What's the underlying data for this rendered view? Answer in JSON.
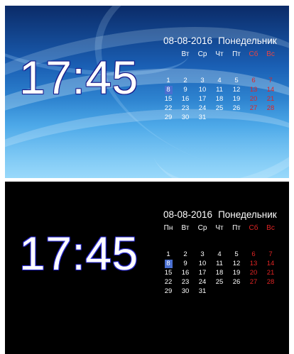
{
  "clock": {
    "time": "17:45"
  },
  "calendar": {
    "date": "08-08-2016",
    "day_name": "Понедельник",
    "weekdays": [
      "Пн",
      "Вт",
      "Ср",
      "Чт",
      "Пт",
      "Сб",
      "Вс"
    ],
    "weeks": [
      [
        "1",
        "2",
        "3",
        "4",
        "5",
        "6",
        "7"
      ],
      [
        "8",
        "9",
        "10",
        "11",
        "12",
        "13",
        "14"
      ],
      [
        "15",
        "16",
        "17",
        "18",
        "19",
        "20",
        "21"
      ],
      [
        "22",
        "23",
        "24",
        "25",
        "26",
        "27",
        "28"
      ],
      [
        "29",
        "30",
        "31",
        "",
        "",
        "",
        ""
      ]
    ],
    "today": "8"
  },
  "colors": {
    "weekend": "#e02424",
    "today_highlight": "#4a6fd0",
    "clock_outline": "#2a2ad0"
  },
  "panels": {
    "top": {
      "background": "blue-streaks-wallpaper"
    },
    "bottom": {
      "background": "black"
    }
  }
}
